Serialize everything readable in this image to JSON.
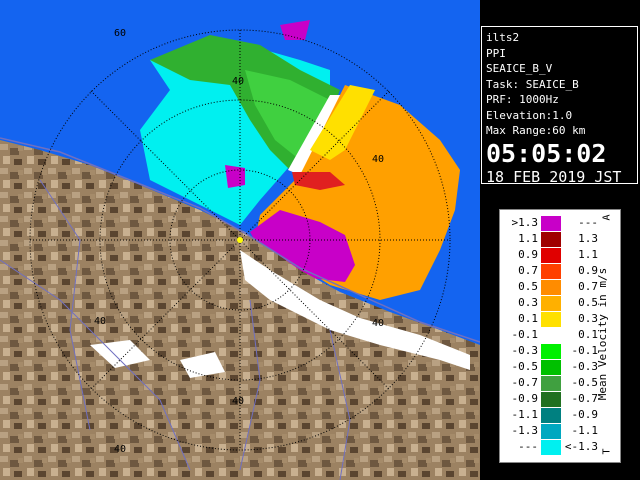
{
  "info": {
    "radar": "ilts2",
    "scan": "PPI",
    "product": "SEAICE_B_V",
    "task": "Task: SEAICE_B",
    "prf": "PRF: 1000Hz",
    "elevation": "Elevation:1.0",
    "max_range": "Max Range:60 km",
    "time": "05:05:02",
    "date": "18 FEB 2019 JST"
  },
  "range_rings": {
    "labels": [
      "60",
      "40",
      "40",
      "40",
      "40",
      "40",
      "40",
      "60",
      "60"
    ]
  },
  "legend": {
    "unit": "Mean Velocity in m/s",
    "top_marker": "A",
    "bottom_marker": "T",
    "rows": [
      {
        "lo": ">1.3",
        "hi": "---",
        "color": "#c800c8"
      },
      {
        "lo": "1.1",
        "hi": "1.3",
        "color": "#a00000"
      },
      {
        "lo": "0.9",
        "hi": "1.1",
        "color": "#e00000"
      },
      {
        "lo": "0.7",
        "hi": "0.9",
        "color": "#ff4000"
      },
      {
        "lo": "0.5",
        "hi": "0.7",
        "color": "#ff8c00"
      },
      {
        "lo": "0.3",
        "hi": "0.5",
        "color": "#ffb000"
      },
      {
        "lo": "0.1",
        "hi": "0.3",
        "color": "#ffe000"
      },
      {
        "lo": "-0.1",
        "hi": "0.1",
        "color": "#ffffff"
      },
      {
        "lo": "-0.3",
        "hi": "-0.1",
        "color": "#00f000"
      },
      {
        "lo": "-0.5",
        "hi": "-0.3",
        "color": "#00c000"
      },
      {
        "lo": "-0.7",
        "hi": "-0.5",
        "color": "#40a040"
      },
      {
        "lo": "-0.9",
        "hi": "-0.7",
        "color": "#207020"
      },
      {
        "lo": "-1.1",
        "hi": "-0.9",
        "color": "#008080"
      },
      {
        "lo": "-1.3",
        "hi": "-1.1",
        "color": "#00a8c0"
      },
      {
        "lo": "---",
        "hi": "<-1.3",
        "color": "#00f0f0"
      }
    ]
  },
  "colors": {
    "sea": "#1464f0",
    "land_light": "#b8a080",
    "land_dark": "#5a4530",
    "snow": "#ffffff",
    "ring": "#000000",
    "roads": "#7070c0"
  }
}
